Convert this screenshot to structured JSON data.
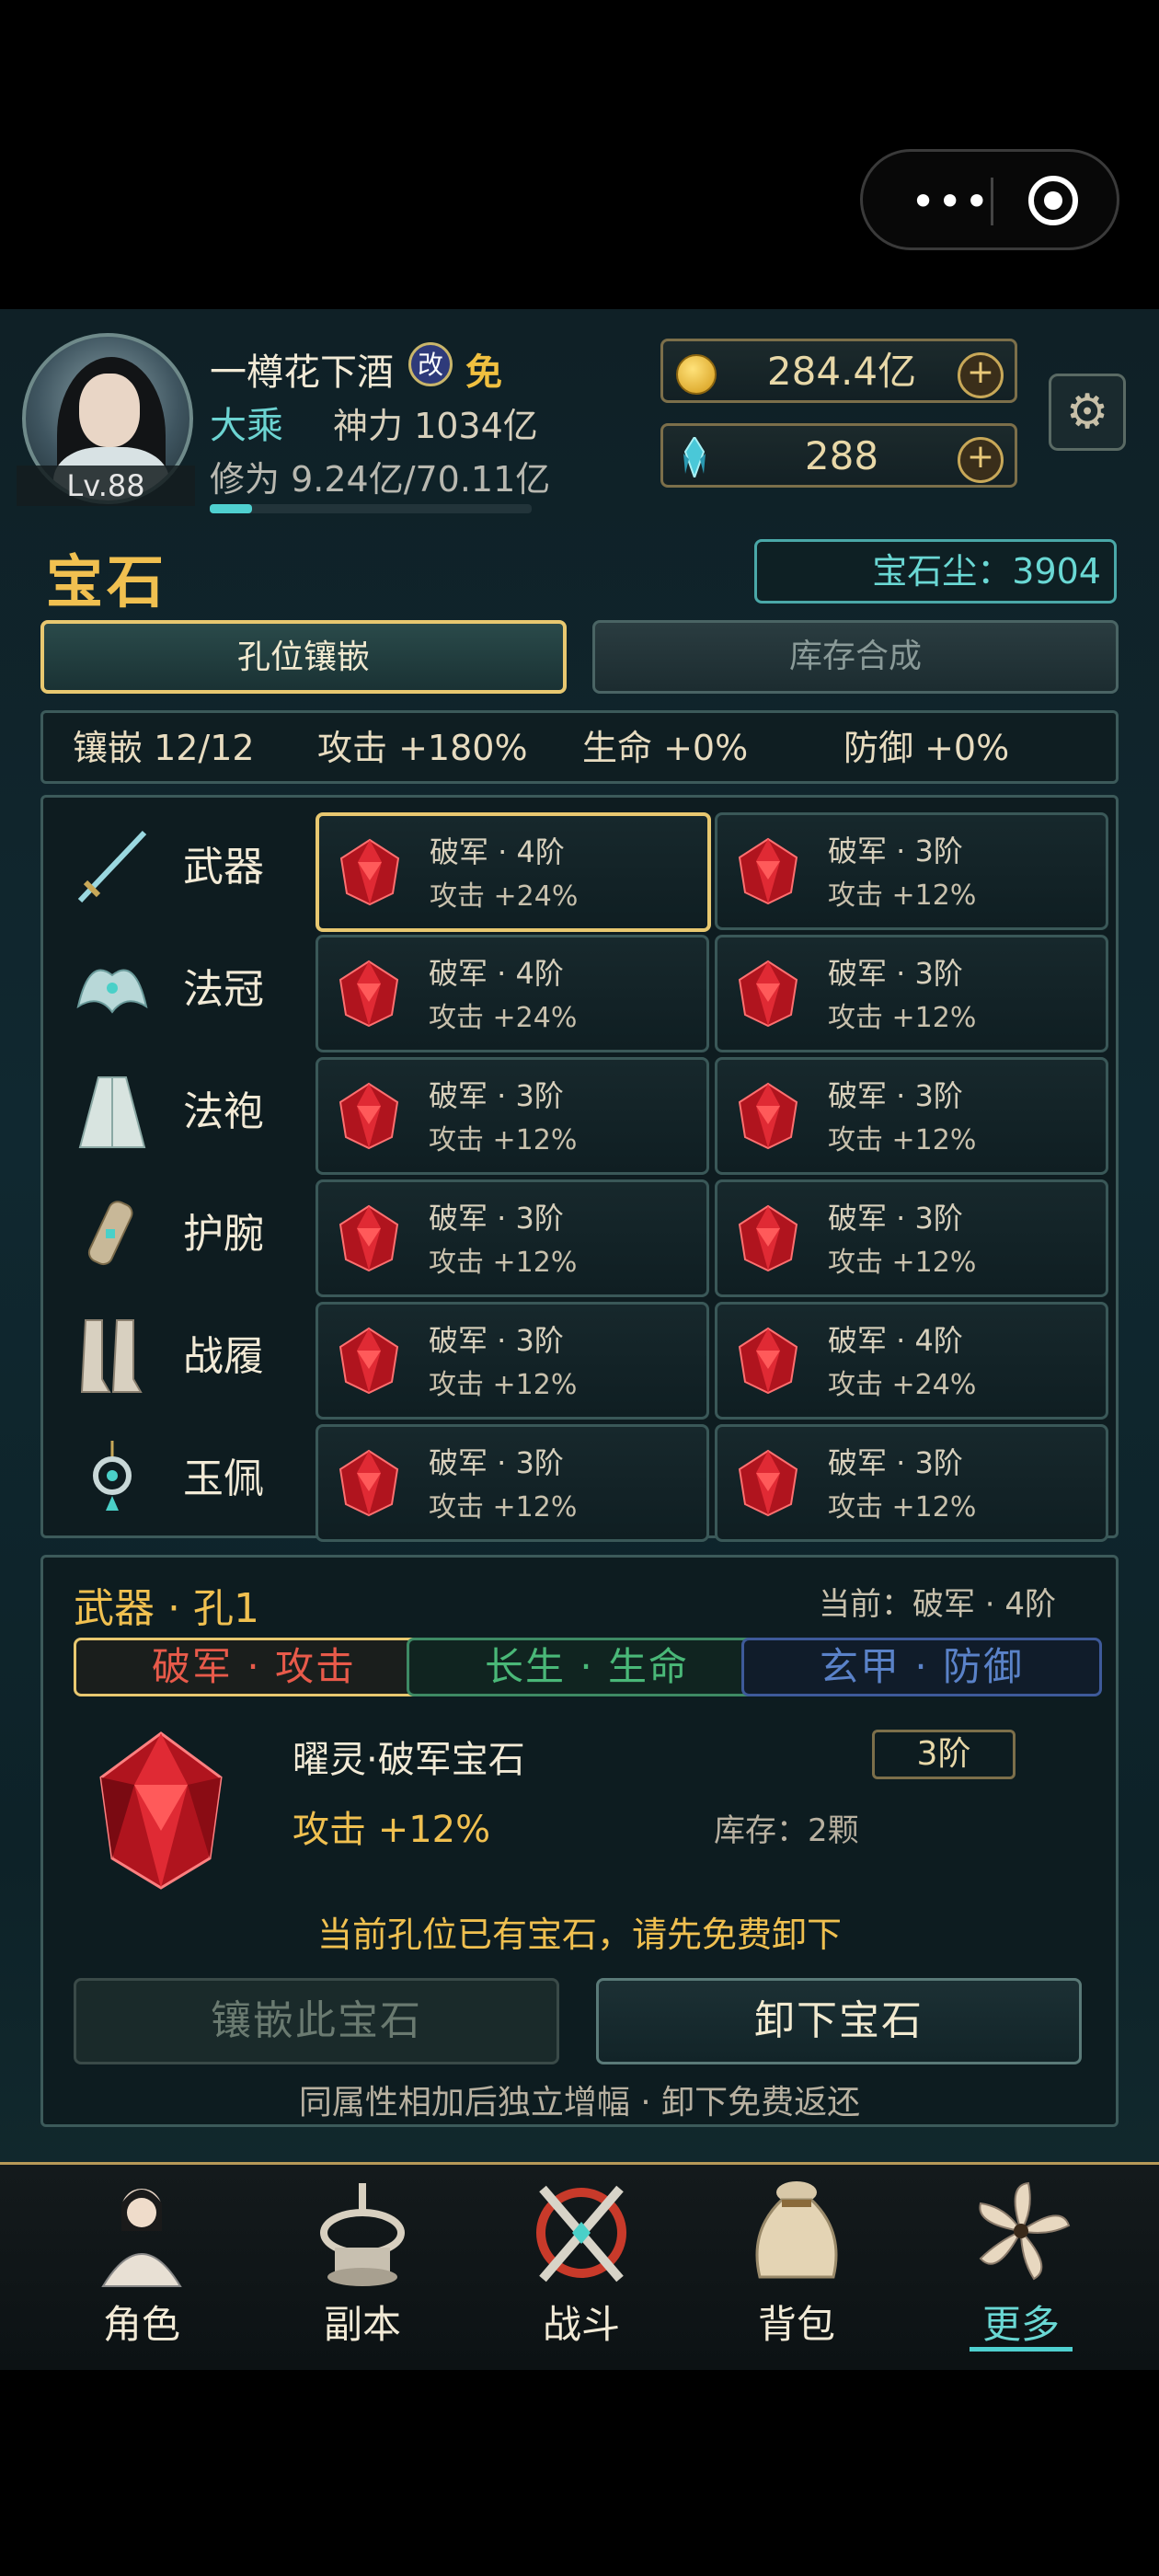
{
  "player": {
    "level": "Lv.88",
    "name": "一樽花下酒",
    "name_badge": "改",
    "name_tag": "免",
    "realm": "大乘",
    "power": "神力 1034亿",
    "cultivation": "修为 9.24亿/70.11亿",
    "cultivation_progress": 0.13
  },
  "resources": {
    "gold": "284.4亿",
    "crystal": "288"
  },
  "page": {
    "title": "宝石",
    "gem_dust": "宝石尘：3904",
    "tabs": [
      "孔位镶嵌",
      "库存合成"
    ]
  },
  "summary": {
    "inlay": "镶嵌 12/12",
    "attack": "攻击 +180%",
    "hp": "生命 +0%",
    "defense": "防御 +0%"
  },
  "slots": [
    {
      "name": "武器",
      "gems": [
        {
          "n": "破军 · 4阶",
          "a": "攻击 +24%"
        },
        {
          "n": "破军 · 3阶",
          "a": "攻击 +12%"
        }
      ]
    },
    {
      "name": "法冠",
      "gems": [
        {
          "n": "破军 · 4阶",
          "a": "攻击 +24%"
        },
        {
          "n": "破军 · 3阶",
          "a": "攻击 +12%"
        }
      ]
    },
    {
      "name": "法袍",
      "gems": [
        {
          "n": "破军 · 3阶",
          "a": "攻击 +12%"
        },
        {
          "n": "破军 · 3阶",
          "a": "攻击 +12%"
        }
      ]
    },
    {
      "name": "护腕",
      "gems": [
        {
          "n": "破军 · 3阶",
          "a": "攻击 +12%"
        },
        {
          "n": "破军 · 3阶",
          "a": "攻击 +12%"
        }
      ]
    },
    {
      "name": "战履",
      "gems": [
        {
          "n": "破军 · 3阶",
          "a": "攻击 +12%"
        },
        {
          "n": "破军 · 4阶",
          "a": "攻击 +24%"
        }
      ]
    },
    {
      "name": "玉佩",
      "gems": [
        {
          "n": "破军 · 3阶",
          "a": "攻击 +12%"
        },
        {
          "n": "破军 · 3阶",
          "a": "攻击 +12%"
        }
      ]
    }
  ],
  "detail": {
    "title": "武器 · 孔1",
    "current": "当前：破军 · 4阶",
    "filters": [
      "破军 · 攻击",
      "长生 · 生命",
      "玄甲 · 防御"
    ],
    "gem_name": "曜灵·破军宝石",
    "tier": "3阶",
    "attr": "攻击 +12%",
    "stock": "库存：2颗",
    "warning": "当前孔位已有宝石，请先免费卸下",
    "btn_inlay": "镶嵌此宝石",
    "btn_remove": "卸下宝石",
    "footer": "同属性相加后独立增幅 · 卸下免费返还"
  },
  "nav": [
    "角色",
    "副本",
    "战斗",
    "背包",
    "更多"
  ],
  "colors": {
    "accent_gold": "#f0c050",
    "accent_cyan": "#4fd0d0",
    "gem_red": "#d0202a"
  }
}
